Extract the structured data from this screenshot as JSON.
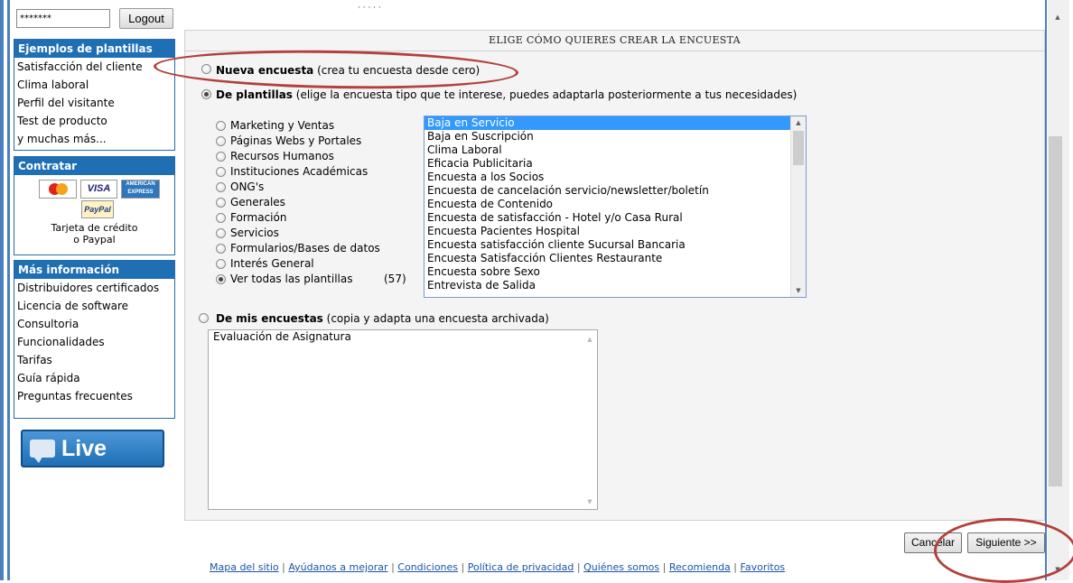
{
  "login": {
    "password_mask": "*******",
    "logout_label": "Logout"
  },
  "sidebar": {
    "templates_header": "Ejemplos de plantillas",
    "template_links": [
      "Satisfacción del cliente",
      "Clima laboral",
      "Perfil del visitante",
      "Test de producto",
      "y muchas más..."
    ],
    "contract_header": "Contratar",
    "payment_cards": [
      "MasterCard",
      "VISA",
      "AMERICAN EXPRESS",
      "PayPal"
    ],
    "payment_text_1": "Tarjeta de crédito",
    "payment_text_2": "o Paypal",
    "info_header": "Más información",
    "info_links": [
      "Distribuidores certificados",
      "Licencia de software",
      "Consultoria",
      "Funcionalidades",
      "Tarifas",
      "Guía rápida",
      "Preguntas frecuentes"
    ],
    "live_chat": "Live Chat"
  },
  "main": {
    "title": "ELIGE CÓMO QUIERES CREAR LA ENCUESTA",
    "option_new": {
      "label": "Nueva encuesta",
      "hint": "(crea tu encuesta desde cero)"
    },
    "option_templates": {
      "label": "De plantillas",
      "hint": "(elige la encuesta tipo que te interese, puedes adaptarla posteriormente a tus necesidades)"
    },
    "categories": [
      "Marketing y Ventas",
      "Páginas Webs y Portales",
      "Recursos Humanos",
      "Instituciones Académicas",
      "ONG's",
      "Generales",
      "Formación",
      "Servicios",
      "Formularios/Bases de datos",
      "Interés General",
      "Ver todas las plantillas"
    ],
    "all_templates_count": "(57)",
    "selected_category": "Ver todas las plantillas",
    "template_list": [
      "Baja en Servicio",
      "Baja en Suscripción",
      "Clima Laboral",
      "Eficacia Publicitaria",
      "Encuesta a los Socios",
      "Encuesta de cancelación servicio/newsletter/boletín",
      "Encuesta de Contenido",
      "Encuesta de satisfacción - Hotel y/o Casa Rural",
      "Encuesta Pacientes Hospital",
      "Encuesta satisfacción cliente Sucursal Bancaria",
      "Encuesta Satisfacción Clientes Restaurante",
      "Encuesta sobre Sexo",
      "Entrevista de Salida"
    ],
    "selected_template": "Baja en Servicio",
    "option_mine": {
      "label": "De mis encuestas",
      "hint": "(copia y adapta una encuesta archivada)"
    },
    "my_surveys": [
      "Evaluación de Asignatura"
    ]
  },
  "actions": {
    "cancel_label": "Cancelar",
    "next_label": "Siguiente >>"
  },
  "footer": {
    "links": [
      "Mapa del sitio",
      "Ayúdanos a mejorar",
      "Condiciones",
      "Política de privacidad",
      "Quiénes somos",
      "Recomienda",
      "Favoritos"
    ],
    "separator": "|"
  },
  "colors": {
    "sidebar_header": "#1f6fb5",
    "selection": "#3399ff",
    "annotation": "#b2403b"
  }
}
